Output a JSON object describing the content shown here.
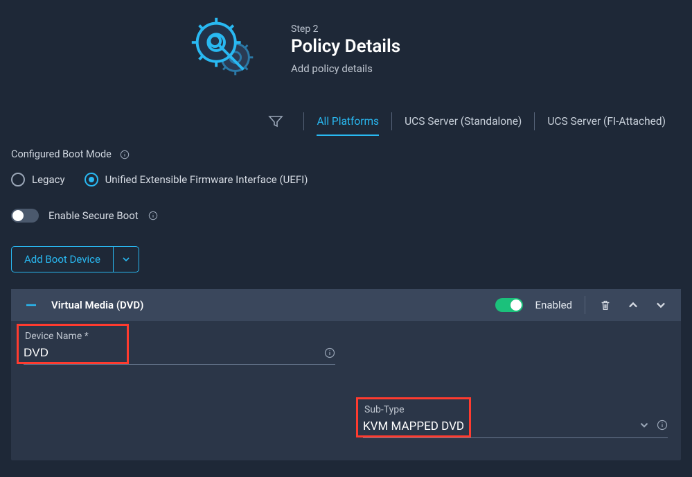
{
  "wizard": {
    "step_label": "Step 2",
    "title": "Policy Details",
    "subtitle": "Add policy details"
  },
  "platform_tabs": {
    "t0": "All Platforms",
    "t1": "UCS Server (Standalone)",
    "t2": "UCS Server (FI-Attached)"
  },
  "boot_mode": {
    "section_title": "Configured Boot Mode",
    "legacy_label": "Legacy",
    "uefi_label": "Unified Extensible Firmware Interface (UEFI)",
    "secure_boot_label": "Enable Secure Boot"
  },
  "add_button": {
    "label": "Add Boot Device"
  },
  "device": {
    "title": "Virtual Media (DVD)",
    "enabled_label": "Enabled",
    "name_label": "Device Name *",
    "name_value": "DVD",
    "subtype_label": "Sub-Type",
    "subtype_value": "KVM MAPPED DVD"
  }
}
